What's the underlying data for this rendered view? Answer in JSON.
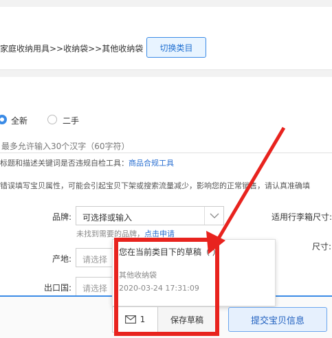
{
  "category": {
    "path": "家庭收纳用具>>收纳袋>>其他收纳袋",
    "switch_label": "切换类目"
  },
  "condition": {
    "options": [
      "全新",
      "二手"
    ],
    "selected": "全新"
  },
  "title_field": {
    "hint": "最多允许输入30个汉字（60字符）"
  },
  "compliance": {
    "text": "标题和描述关键词是否违规自检工具：",
    "link": "商品合规工具"
  },
  "warning": {
    "text": "错误填写宝贝属性，可能会引起宝贝下架或搜索流量减少，影响您的正常销售，请认真准确填"
  },
  "attributes": {
    "brand": {
      "label": "品牌:",
      "value": "可选择或输入",
      "hint": "未找到需要的品牌，",
      "hint_link": "点击申请"
    },
    "origin": {
      "label": "产地:",
      "placeholder": "请选择"
    },
    "export_country": {
      "label": "出口国:",
      "placeholder": "请选择"
    },
    "suitcase_size": {
      "label": "适用行李箱尺寸:"
    },
    "size": {
      "label": "尺寸:"
    }
  },
  "drafts_popup": {
    "title": "您在当前类目下的草稿（ ）",
    "item_name": "其他收纳袋",
    "item_time": "2020-03-24 17:31:09"
  },
  "footer": {
    "draft_count": "1",
    "save_draft": "保存草稿",
    "submit": "提交宝贝信息"
  },
  "colors": {
    "accent": "#3b8be6",
    "link": "#2a6fd1",
    "annotation": "#e8231e"
  }
}
